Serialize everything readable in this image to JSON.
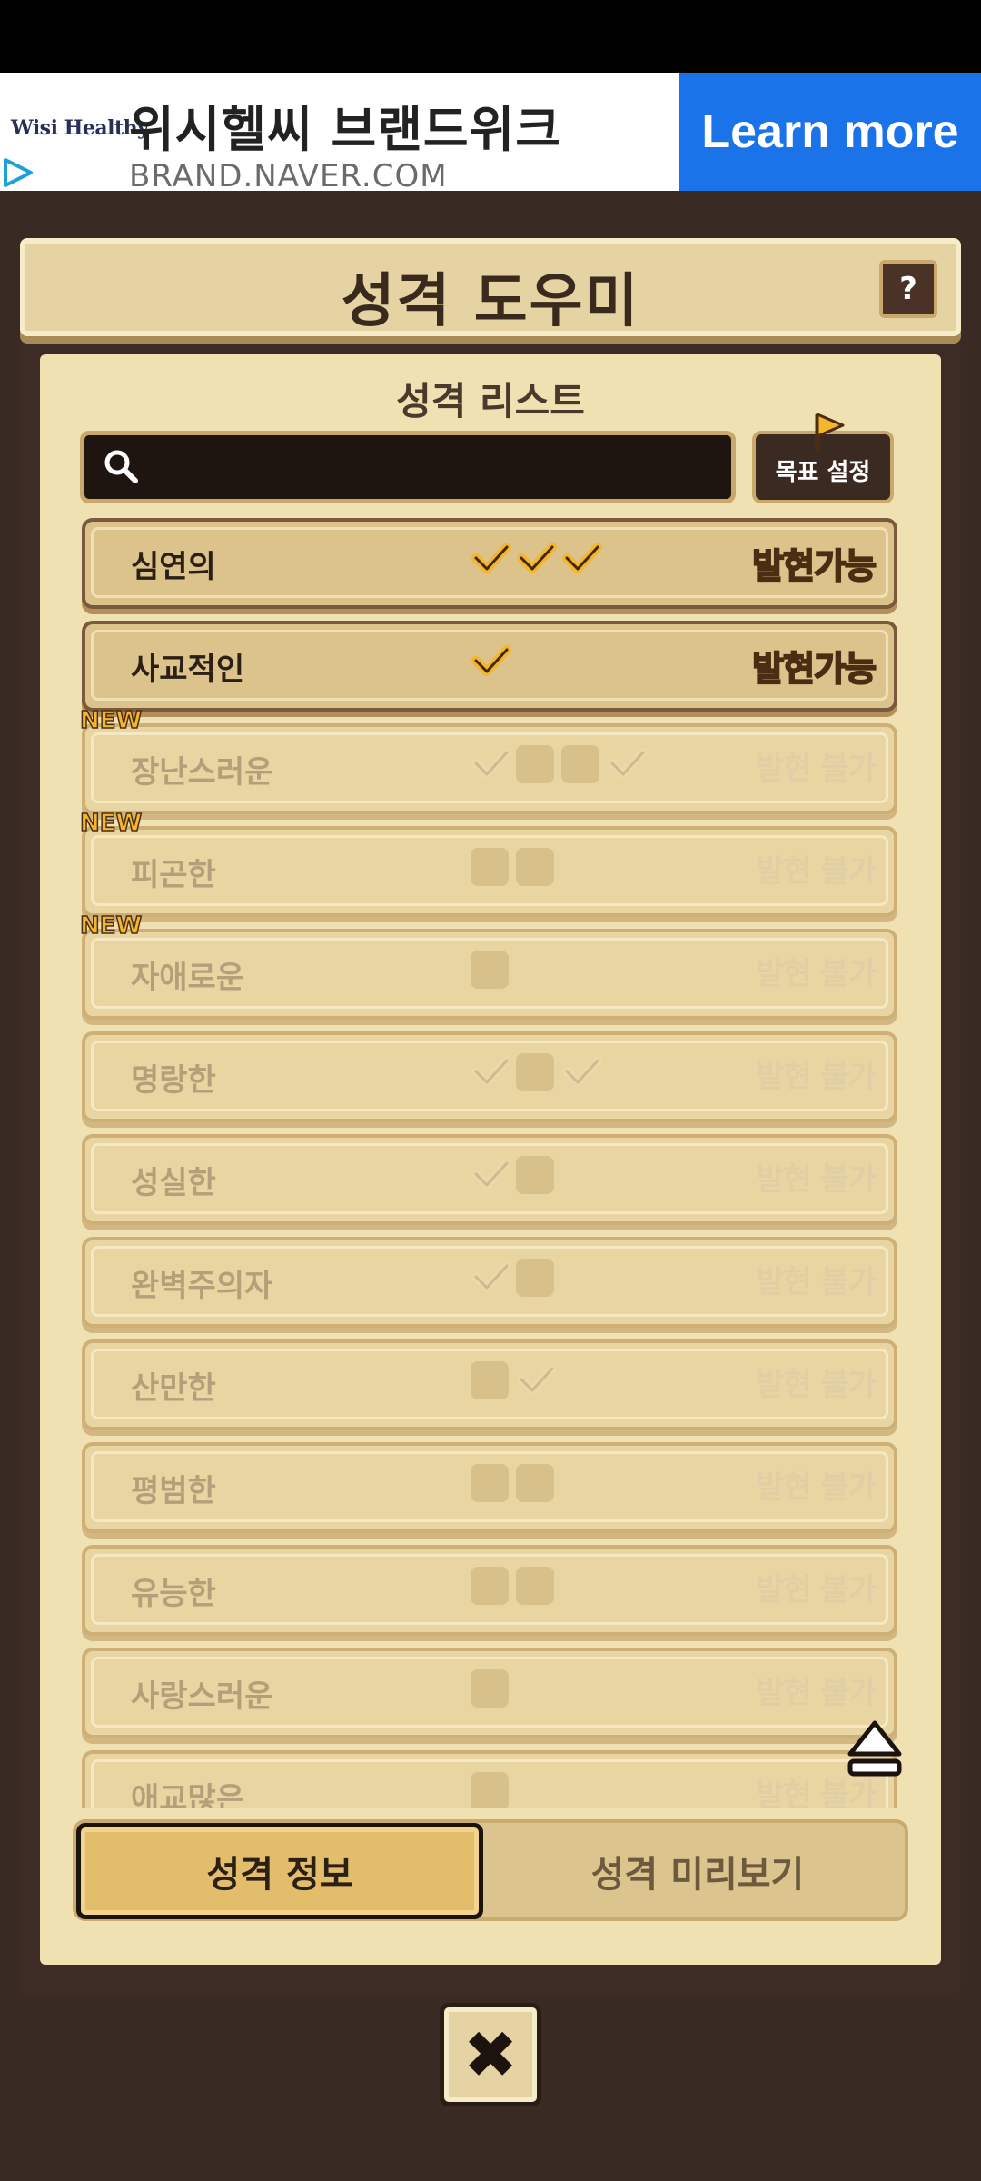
{
  "ad": {
    "logo": "Wisi Healthy",
    "title": "위시헬씨 브랜드위크",
    "url": "BRAND.NAVER.COM",
    "cta": "Learn more"
  },
  "header": {
    "title": "성격 도우미",
    "help": "?"
  },
  "list_section": {
    "title": "성격 리스트",
    "search_value": "",
    "goal_button": "목표 설정"
  },
  "traits": [
    {
      "name": "심연의",
      "status": "발현가능",
      "marks": [
        "check",
        "check",
        "check"
      ],
      "new": ""
    },
    {
      "name": "사교적인",
      "status": "발현가능",
      "marks": [
        "check"
      ],
      "new": ""
    },
    {
      "name": "장난스러운",
      "status": "발현 불가",
      "marks": [
        "check",
        "box",
        "box",
        "check"
      ],
      "new": "NEW"
    },
    {
      "name": "피곤한",
      "status": "발현 불가",
      "marks": [
        "box",
        "box"
      ],
      "new": "NEW"
    },
    {
      "name": "자애로운",
      "status": "발현 불가",
      "marks": [
        "box"
      ],
      "new": "NEW"
    },
    {
      "name": "명랑한",
      "status": "발현 불가",
      "marks": [
        "check",
        "box",
        "check"
      ],
      "new": ""
    },
    {
      "name": "성실한",
      "status": "발현 불가",
      "marks": [
        "check",
        "box"
      ],
      "new": ""
    },
    {
      "name": "완벽주의자",
      "status": "발현 불가",
      "marks": [
        "check",
        "box"
      ],
      "new": ""
    },
    {
      "name": "산만한",
      "status": "발현 불가",
      "marks": [
        "box",
        "check"
      ],
      "new": ""
    },
    {
      "name": "평범한",
      "status": "발현 불가",
      "marks": [
        "box",
        "box"
      ],
      "new": ""
    },
    {
      "name": "유능한",
      "status": "발현 불가",
      "marks": [
        "box",
        "box"
      ],
      "new": ""
    },
    {
      "name": "사랑스러운",
      "status": "발현 불가",
      "marks": [
        "box"
      ],
      "new": ""
    },
    {
      "name": "애교많은",
      "status": "발현 불가",
      "marks": [
        "box"
      ],
      "new": ""
    }
  ],
  "tabs": {
    "info": "성격 정보",
    "preview": "성격 미리보기"
  },
  "close": "✖"
}
